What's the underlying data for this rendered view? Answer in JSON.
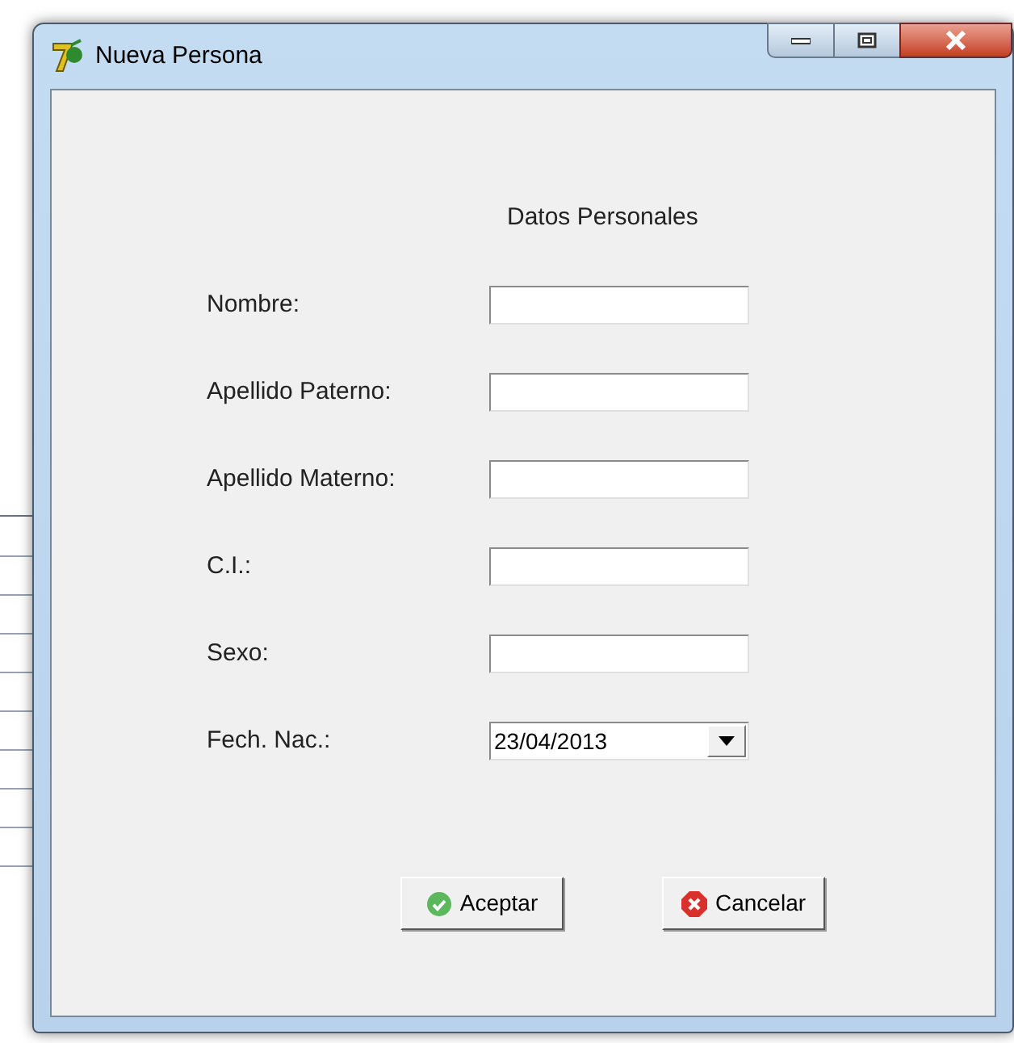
{
  "window": {
    "title": "Nueva Persona"
  },
  "section_title": "Datos Personales",
  "fields": [
    {
      "kind": "text",
      "label": "Nombre:"
    },
    {
      "kind": "text",
      "label": "Apellido Paterno:"
    },
    {
      "kind": "text",
      "label": "Apellido Materno:"
    },
    {
      "kind": "text",
      "label": "C.I.:"
    },
    {
      "kind": "text",
      "label": "Sexo:"
    },
    {
      "kind": "date",
      "label": "Fech. Nac.:",
      "value": "23/04/2013"
    }
  ],
  "buttons": [
    {
      "kind": "ok",
      "label": "Aceptar"
    },
    {
      "kind": "cancel",
      "label": "Cancelar"
    }
  ]
}
